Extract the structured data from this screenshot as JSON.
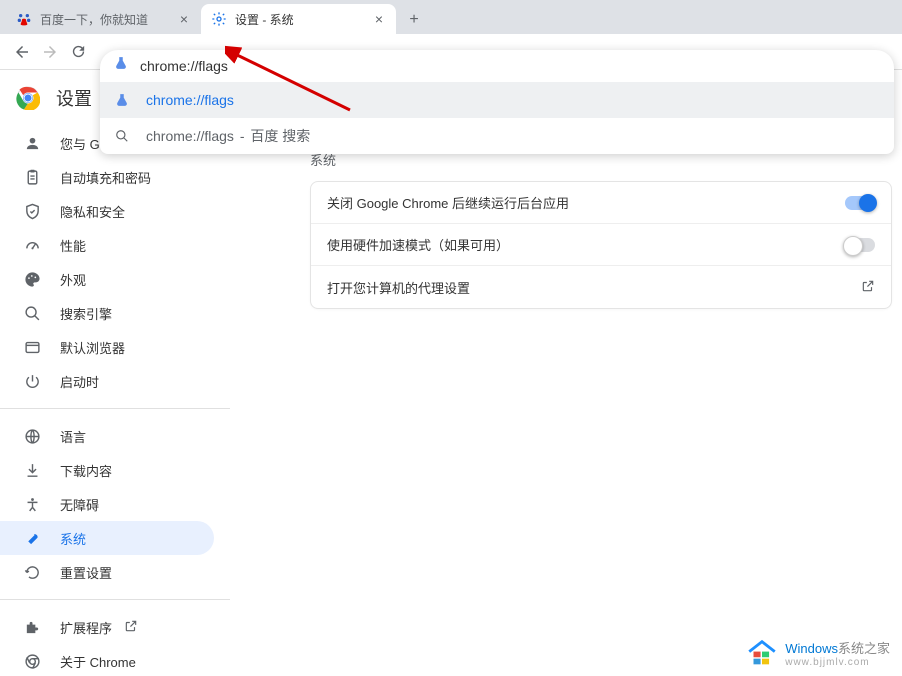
{
  "tabs": [
    {
      "title": "百度一下，你就知道",
      "active": false
    },
    {
      "title": "设置 - 系统",
      "active": true
    }
  ],
  "omnibox": {
    "input": "chrome://flags",
    "suggestions": [
      {
        "type": "flask",
        "main": "chrome://flags",
        "highlighted": true
      },
      {
        "type": "search",
        "main": "chrome://flags",
        "secondary": "百度 搜索",
        "highlighted": false
      }
    ]
  },
  "settings_title": "设置",
  "sidebar": {
    "groups": [
      [
        {
          "key": "you-google",
          "icon": "person",
          "label": "您与 Google"
        },
        {
          "key": "autofill",
          "icon": "clipboard",
          "label": "自动填充和密码"
        },
        {
          "key": "privacy",
          "icon": "shield",
          "label": "隐私和安全"
        },
        {
          "key": "performance",
          "icon": "speedometer",
          "label": "性能"
        },
        {
          "key": "appearance",
          "icon": "palette",
          "label": "外观"
        },
        {
          "key": "search-engine",
          "icon": "search",
          "label": "搜索引擎"
        },
        {
          "key": "default-browser",
          "icon": "browser",
          "label": "默认浏览器"
        },
        {
          "key": "on-startup",
          "icon": "power",
          "label": "启动时"
        }
      ],
      [
        {
          "key": "languages",
          "icon": "globe",
          "label": "语言"
        },
        {
          "key": "downloads",
          "icon": "download",
          "label": "下载内容"
        },
        {
          "key": "accessibility",
          "icon": "accessibility",
          "label": "无障碍"
        },
        {
          "key": "system",
          "icon": "wrench",
          "label": "系统",
          "active": true
        },
        {
          "key": "reset",
          "icon": "restore",
          "label": "重置设置"
        }
      ],
      [
        {
          "key": "extensions",
          "icon": "puzzle",
          "label": "扩展程序",
          "external": true
        },
        {
          "key": "about",
          "icon": "chrome",
          "label": "关于 Chrome"
        }
      ]
    ]
  },
  "main": {
    "section_title": "系统",
    "rows": [
      {
        "label": "关闭 Google Chrome 后继续运行后台应用",
        "control": "toggle-on"
      },
      {
        "label": "使用硬件加速模式（如果可用）",
        "control": "toggle-off"
      },
      {
        "label": "打开您计算机的代理设置",
        "control": "link-out"
      }
    ]
  },
  "watermark": {
    "brand_blue": "Windows",
    "brand_grey": "系统之家",
    "url": "www.bjjmlv.com"
  }
}
